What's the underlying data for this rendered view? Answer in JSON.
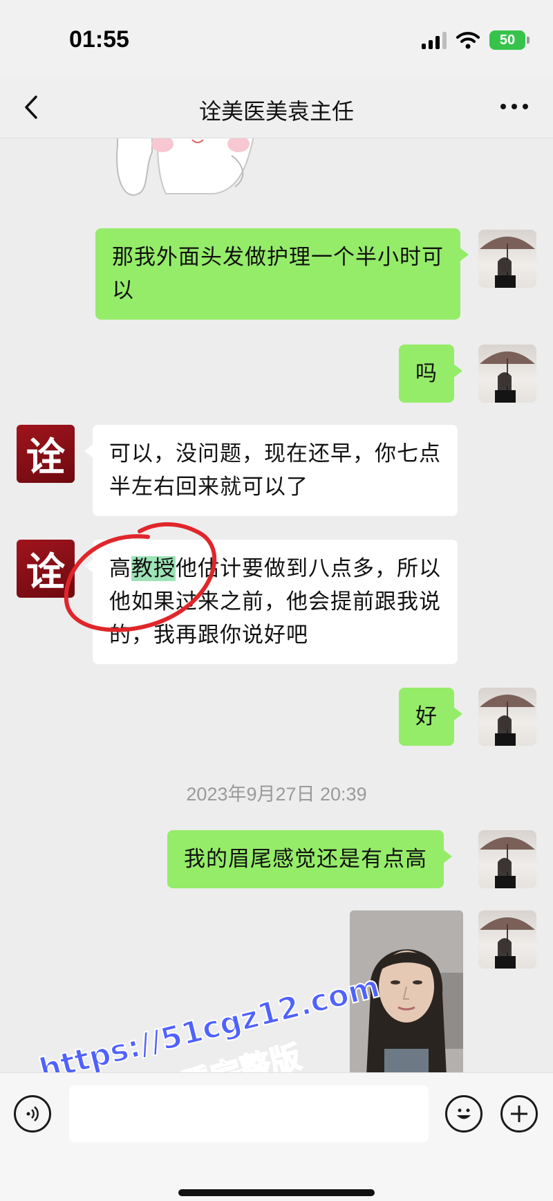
{
  "status_bar": {
    "time": "01:55",
    "battery": "50"
  },
  "nav": {
    "title": "诠美医美袁主任"
  },
  "contact_avatar_char": "诠",
  "messages": [
    {
      "side": "me",
      "text": "那我外面头发做护理一个半小时可以"
    },
    {
      "side": "me",
      "text": "吗"
    },
    {
      "side": "them",
      "text": "可以，没问题，现在还早，你七点半左右回来就可以了"
    },
    {
      "side": "them",
      "pre": "高",
      "highlight": "教授",
      "post": "他估计要做到八点多，所以他如果过来之前，他会提前跟我说的，我再跟你说好吧"
    },
    {
      "side": "me",
      "text": "好"
    },
    {
      "side": "me",
      "text": "我的眉尾感觉还是有点高"
    }
  ],
  "timestamp": "2023年9月27日 20:39",
  "watermark": {
    "url": "https://51cgz12.com",
    "subtitle": "看完整版"
  },
  "input": {
    "placeholder": ""
  },
  "colors": {
    "me_bubble": "#95ec69",
    "them_bubble": "#ffffff",
    "highlight": "#9ee3b8",
    "circle": "#e0262b",
    "watermark": "#4f62ff"
  }
}
